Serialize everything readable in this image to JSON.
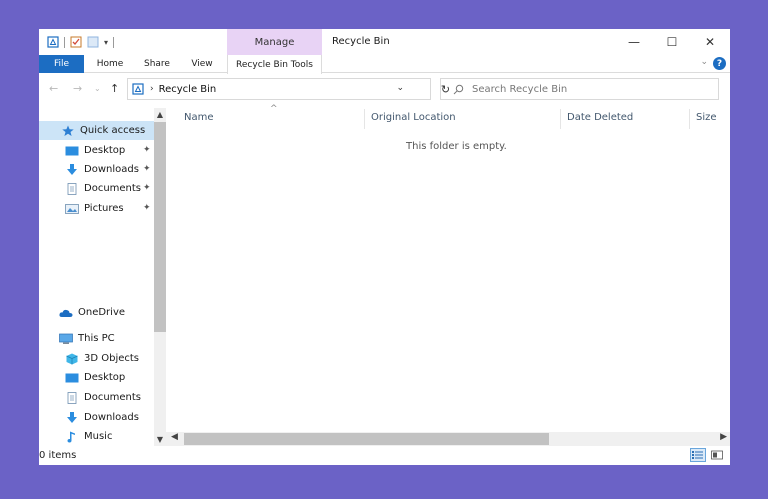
{
  "window": {
    "title": "Recycle Bin",
    "contextual_tab_group": "Manage",
    "controls": {
      "minimize": "—",
      "maximize": "☐",
      "close": "✕"
    }
  },
  "ribbon": {
    "tabs": [
      "File",
      "Home",
      "Share",
      "View"
    ],
    "contextual_tab": "Recycle Bin Tools",
    "help": "?",
    "expand": "⌄"
  },
  "address_bar": {
    "breadcrumb_separator": "›",
    "path": "Recycle Bin",
    "dropdown": "⌄",
    "refresh": "↻"
  },
  "nav_buttons": {
    "back": "←",
    "forward": "→",
    "recent": "⌄",
    "up": "↑"
  },
  "search": {
    "placeholder": "Search Recycle Bin",
    "icon": "search-icon"
  },
  "navigation_pane": {
    "quick_access": {
      "label": "Quick access",
      "icon": "star-icon"
    },
    "quick_items": [
      {
        "label": "Desktop",
        "icon": "desktop-icon",
        "pinned": true
      },
      {
        "label": "Downloads",
        "icon": "downloads-icon",
        "pinned": true
      },
      {
        "label": "Documents",
        "icon": "documents-icon",
        "pinned": true
      },
      {
        "label": "Pictures",
        "icon": "pictures-icon",
        "pinned": true
      }
    ],
    "onedrive": {
      "label": "OneDrive",
      "icon": "cloud-icon"
    },
    "this_pc": {
      "label": "This PC",
      "icon": "computer-icon"
    },
    "pc_items": [
      {
        "label": "3D Objects",
        "icon": "cube-icon"
      },
      {
        "label": "Desktop",
        "icon": "desktop-icon"
      },
      {
        "label": "Documents",
        "icon": "documents-icon"
      },
      {
        "label": "Downloads",
        "icon": "downloads-icon"
      },
      {
        "label": "Music",
        "icon": "music-icon"
      }
    ],
    "pin_glyph": "📌"
  },
  "file_list": {
    "columns": [
      "Name",
      "Original Location",
      "Date Deleted",
      "Size"
    ],
    "sort_indicator": "^",
    "empty_message": "This folder is empty."
  },
  "status_bar": {
    "item_count": "0 items"
  },
  "colors": {
    "background": "#6b62c6",
    "file_tab": "#1c6dc2",
    "contextual_tab": "#e8d3f5",
    "selected_item": "#cce4f7",
    "column_header_text": "#42576d"
  }
}
